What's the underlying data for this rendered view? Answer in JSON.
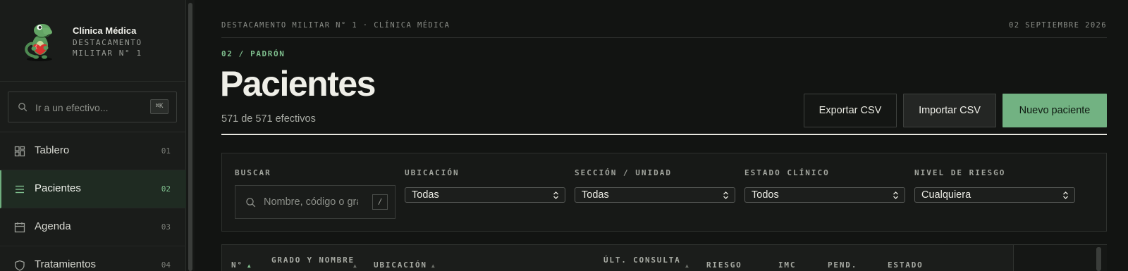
{
  "brand": {
    "title": "Clínica Médica",
    "subtitle": "Destacamento Militar N° 1"
  },
  "jump": {
    "placeholder": "Ir a un efectivo...",
    "shortcut": "⌘K"
  },
  "nav": {
    "items": [
      {
        "label": "Tablero",
        "num": "01",
        "icon": "grid-icon"
      },
      {
        "label": "Pacientes",
        "num": "02",
        "icon": "list-icon",
        "active": true
      },
      {
        "label": "Agenda",
        "num": "03",
        "icon": "calendar-icon"
      },
      {
        "label": "Tratamientos",
        "num": "04",
        "icon": "shield-icon"
      }
    ]
  },
  "header": {
    "breadcrumb": "DESTACAMENTO MILITAR N° 1 · CLÍNICA MÉDICA",
    "date": "02 SEPTIEMBRE 2026",
    "section": "02 / PADRÓN",
    "title": "Pacientes",
    "count": "571 de 571 efectivos"
  },
  "actions": {
    "export": "Exportar CSV",
    "import": "Importar CSV",
    "new": "Nuevo paciente"
  },
  "filters": {
    "search_label": "BUSCAR",
    "search_placeholder": "Nombre, código o grado",
    "search_shortcut": "/",
    "ubicacion_label": "UBICACIÓN",
    "ubicacion_value": "Todas",
    "seccion_label": "SECCIÓN / UNIDAD",
    "seccion_value": "Todas",
    "estado_label": "ESTADO CLÍNICO",
    "estado_value": "Todos",
    "riesgo_label": "NIVEL DE RIESGO",
    "riesgo_value": "Cualquiera"
  },
  "table": {
    "columns": [
      "N°",
      "GRADO Y NOMBRE",
      "UBICACIÓN",
      "ÚLT. CONSULTA",
      "RIESGO",
      "IMC",
      "PEND.",
      "ESTADO"
    ]
  },
  "colors": {
    "accent": "#72b282",
    "background": "#121412",
    "sidebar": "#1a1c1a"
  }
}
